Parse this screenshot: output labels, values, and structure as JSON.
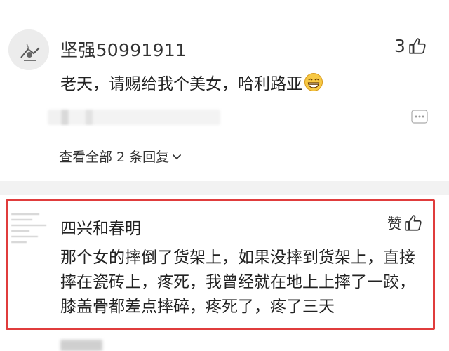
{
  "comments": [
    {
      "username": "坚强50991911",
      "like_count": "3",
      "text": "老天，请赐给我个美女，哈利路亚",
      "emoji": "grin-emoji",
      "view_replies": "查看全部 2 条回复",
      "icons": [
        "thumb-up-icon",
        "more-dots-icon",
        "chevron-down-icon"
      ]
    },
    {
      "username": "四兴和春明",
      "like_label": "赞",
      "text": "那个女的摔倒了货架上，如果没摔到货架上，直接摔在瓷砖上，疼死，我曾经就在地上上摔了一跤，膝盖骨都差点摔碎，疼死了，疼了三天",
      "icons": [
        "thumb-up-icon"
      ]
    }
  ],
  "colors": {
    "highlight_border": "#e03c3c",
    "text": "#222222",
    "separator": "#f2f2f2"
  }
}
